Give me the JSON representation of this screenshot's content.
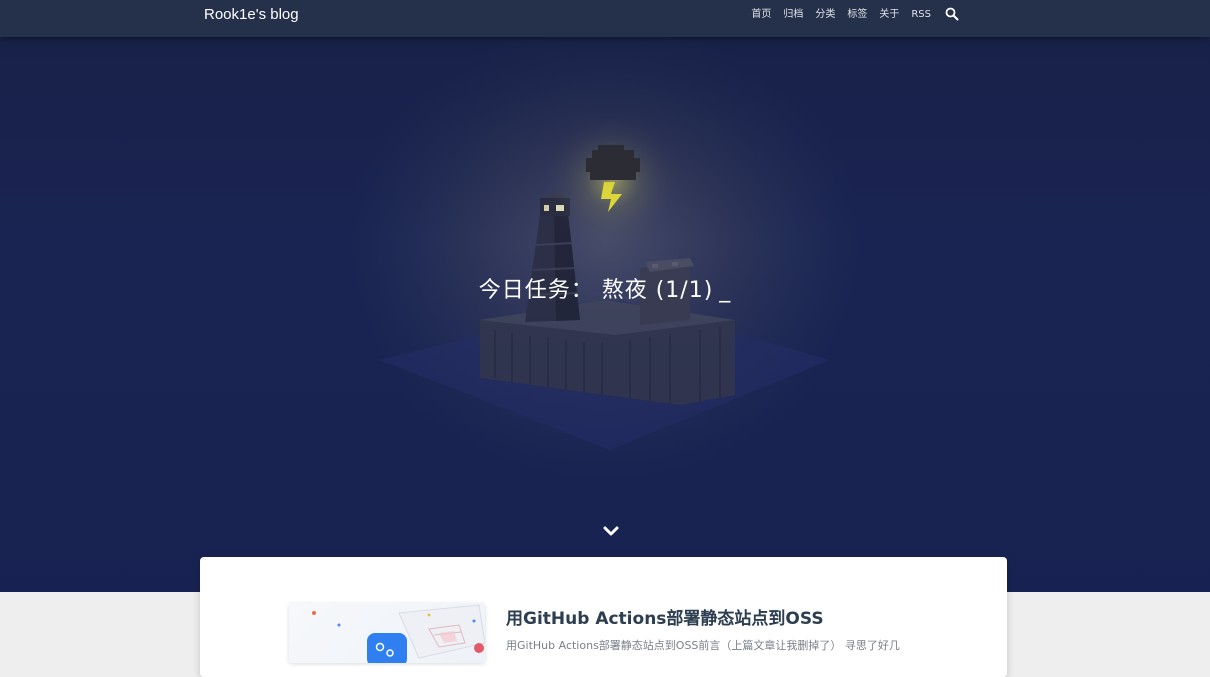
{
  "site": {
    "brand": "Rook1e's blog"
  },
  "nav": {
    "items": [
      {
        "label": "首页"
      },
      {
        "label": "归档"
      },
      {
        "label": "分类"
      },
      {
        "label": "标签"
      },
      {
        "label": "关于"
      },
      {
        "label": "RSS"
      }
    ],
    "search_icon": "search-icon"
  },
  "banner": {
    "headline": "今日任务： 熬夜 (1/1)",
    "cursor": "_",
    "scroll_icon": "chevron-down-icon"
  },
  "posts": [
    {
      "title": "用GitHub Actions部署静态站点到OSS",
      "excerpt": "用GitHub Actions部署静态站点到OSS前言（上篇文章让我删掉了） 寻思了好几"
    }
  ],
  "colors": {
    "navbar": "#25304a",
    "banner": "#1f2a55",
    "card": "#ffffff",
    "title": "#2c3e50",
    "lightning": "#e8e23a"
  }
}
